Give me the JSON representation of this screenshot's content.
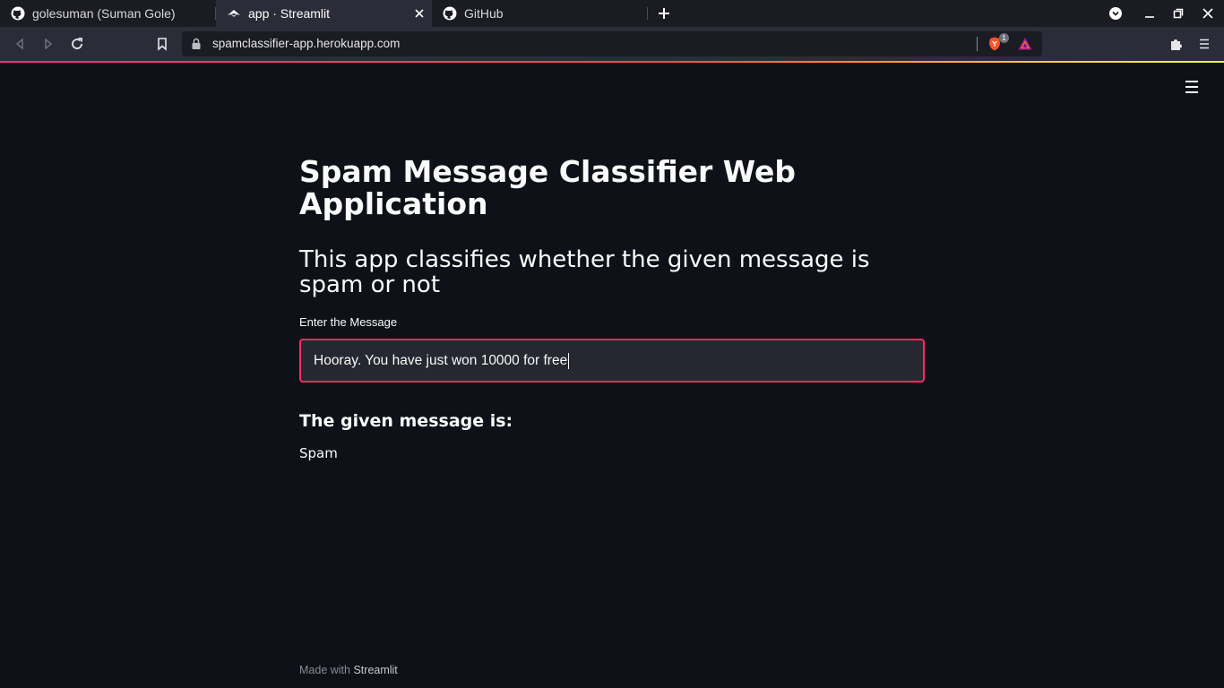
{
  "browser": {
    "tabs": [
      {
        "title": "golesuman (Suman Gole)",
        "icon": "github-icon",
        "active": false
      },
      {
        "title": "app · Streamlit",
        "icon": "streamlit-icon",
        "active": true
      },
      {
        "title": "GitHub",
        "icon": "github-icon",
        "active": false
      }
    ],
    "url": "spamclassifier-app.herokuapp.com",
    "brave_badge": "1",
    "accent_colors": [
      "#ff2b8a",
      "#ff4b4b",
      "#ffcb3b"
    ]
  },
  "app": {
    "title": "Spam Message Classifier Web Application",
    "subtitle": "This app classifies whether the given message is spam or not",
    "input": {
      "label": "Enter the Message",
      "value": "Hooray. You have just won 10000 for free"
    },
    "result_heading": "The given message is:",
    "result_value": "Spam",
    "footer": {
      "prefix": "Made with",
      "link": "Streamlit"
    }
  },
  "colors": {
    "background": "#0e1117",
    "input_bg": "#262730",
    "input_border": "#ff2b5e",
    "text": "#fafafa"
  }
}
